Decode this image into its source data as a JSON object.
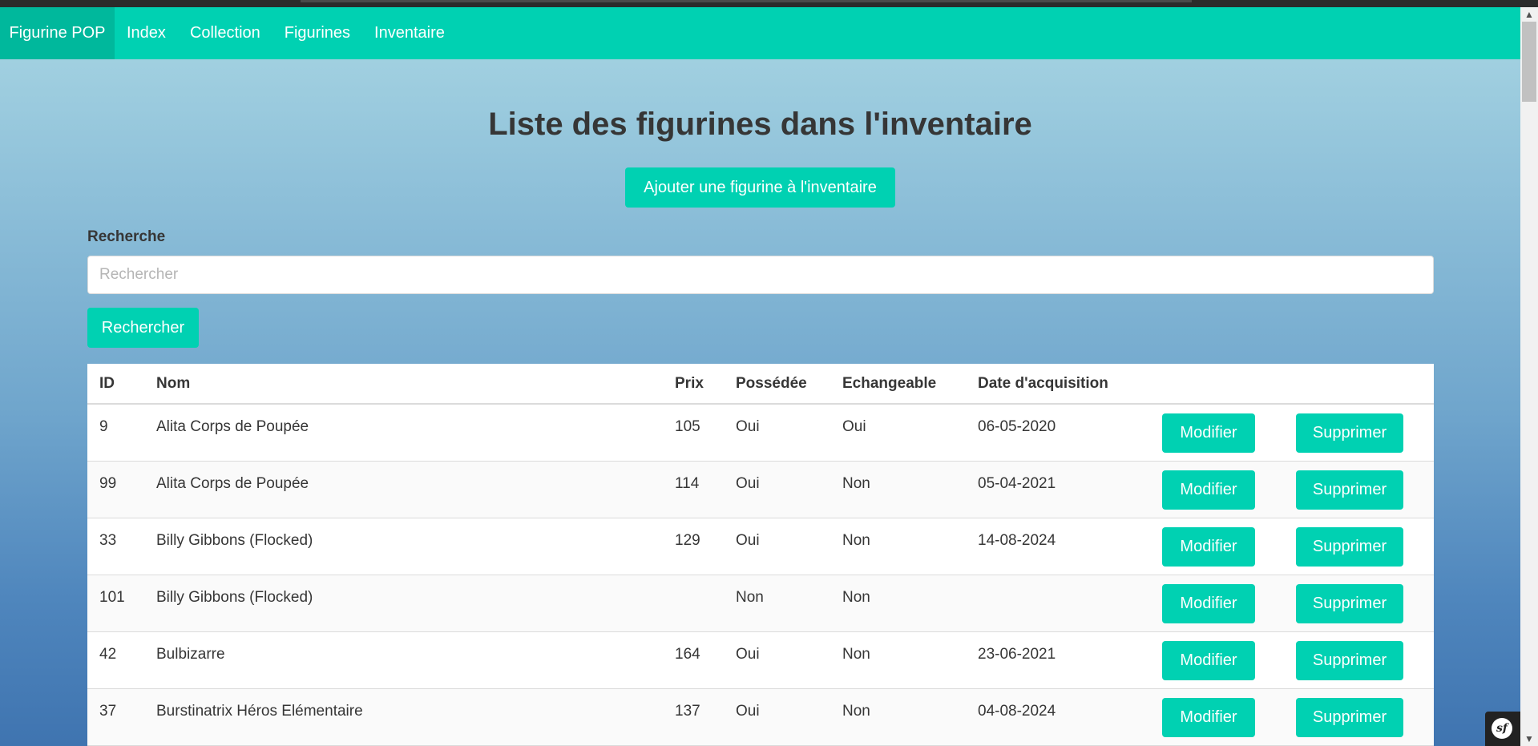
{
  "navbar": {
    "brand": "Figurine POP",
    "links": [
      "Index",
      "Collection",
      "Figurines",
      "Inventaire"
    ]
  },
  "main": {
    "title": "Liste des figurines dans l'inventaire",
    "add_button": "Ajouter une figurine à l'inventaire",
    "search_label": "Recherche",
    "search_placeholder": "Rechercher",
    "search_value": "",
    "search_button": "Rechercher"
  },
  "table": {
    "headers": [
      "ID",
      "Nom",
      "Prix",
      "Possédée",
      "Echangeable",
      "Date d'acquisition"
    ],
    "modify_label": "Modifier",
    "delete_label": "Supprimer",
    "rows": [
      {
        "id": "9",
        "nom": "Alita Corps de Poupée",
        "prix": "105",
        "possedee": "Oui",
        "echangeable": "Oui",
        "date": "06-05-2020"
      },
      {
        "id": "99",
        "nom": "Alita Corps de Poupée",
        "prix": "114",
        "possedee": "Oui",
        "echangeable": "Non",
        "date": "05-04-2021"
      },
      {
        "id": "33",
        "nom": "Billy Gibbons (Flocked)",
        "prix": "129",
        "possedee": "Oui",
        "echangeable": "Non",
        "date": "14-08-2024"
      },
      {
        "id": "101",
        "nom": "Billy Gibbons (Flocked)",
        "prix": "",
        "possedee": "Non",
        "echangeable": "Non",
        "date": ""
      },
      {
        "id": "42",
        "nom": "Bulbizarre",
        "prix": "164",
        "possedee": "Oui",
        "echangeable": "Non",
        "date": "23-06-2021"
      },
      {
        "id": "37",
        "nom": "Burstinatrix Héros Elémentaire",
        "prix": "137",
        "possedee": "Oui",
        "echangeable": "Non",
        "date": "04-08-2024"
      }
    ]
  },
  "theme": {
    "accent": "#00d1b2",
    "brand_bg": "#00b89c",
    "text": "#363636"
  },
  "toolbar": {
    "logo_text": "sf"
  }
}
